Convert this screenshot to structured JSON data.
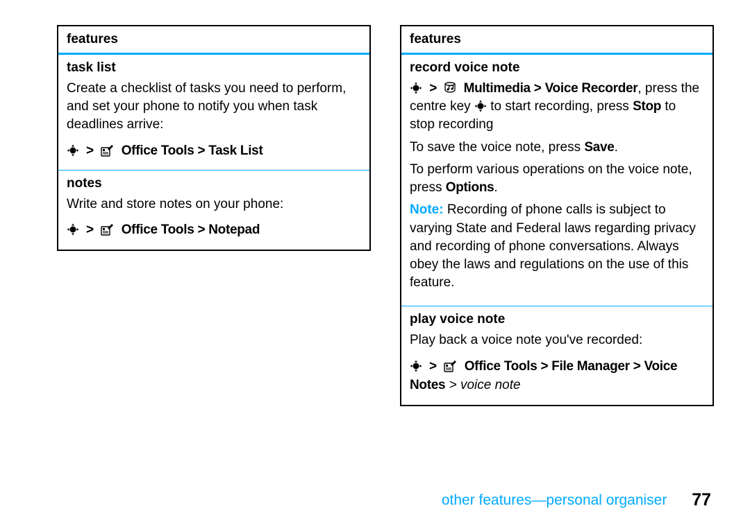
{
  "leftTable": {
    "header": "features",
    "rows": [
      {
        "title": "task list",
        "body_text": "Create a checklist of tasks you need to perform, and set your phone to notify you when task deadlines arrive:",
        "path_menu": "Office Tools",
        "path_rest": " > Task List"
      },
      {
        "title": "notes",
        "body_text": "Write and store notes on your phone:",
        "path_menu": "Office Tools",
        "path_rest": " > Notepad"
      }
    ]
  },
  "rightTable": {
    "header": "features",
    "rows": [
      {
        "title": "record voice note",
        "nav_icon_menu": "Multimedia",
        "nav_rest": " > Voice Recorder",
        "nav_after": ", press the centre key ",
        "nav_after2": " to start recording, press ",
        "stop_label": "Stop",
        "nav_after3": " to stop recording",
        "save_line_a": "To save the voice note, press ",
        "save_label": "Save",
        "save_line_b": ".",
        "ops_line_a": "To perform various operations on the voice note, press ",
        "options_label": "Options",
        "ops_line_b": ".",
        "note_label": "Note: ",
        "note_text": "Recording of phone calls is subject to varying State and Federal laws regarding privacy and recording of phone conversations. Always obey the laws and regulations on the use of this feature."
      },
      {
        "title": "play voice note",
        "body_text": "Play back a voice note you've recorded:",
        "path_menu": "Office Tools",
        "path_rest_a": " > File Manager > Voice Notes",
        "path_gt": " > ",
        "path_italic": "voice note"
      }
    ]
  },
  "footer": {
    "title": "other features—personal organiser",
    "page": "77"
  }
}
